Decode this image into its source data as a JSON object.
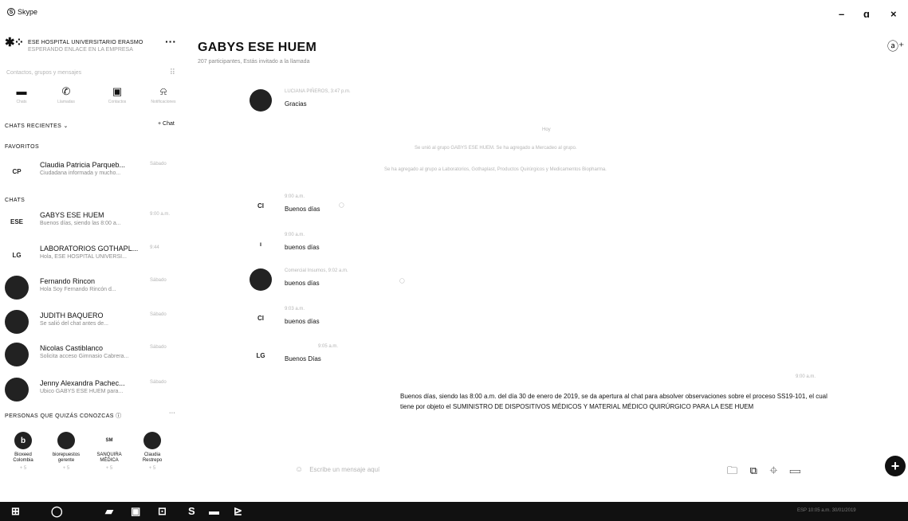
{
  "app": {
    "title": "Skype",
    "minimize": "–",
    "maximize": "ɑ",
    "close": "×"
  },
  "profile": {
    "name": "ESE HOSPITAL UNIVERSITARIO ERASMO",
    "status": "ESPERANDO ENLACE EN LA EMPRESA",
    "more": "···"
  },
  "search": {
    "placeholder": "Contactos, grupos y mensajes",
    "dialpad": "⠿"
  },
  "nav": [
    {
      "icon": "chat-icon",
      "glyph": "▬",
      "label": "Chats"
    },
    {
      "icon": "phone-icon",
      "glyph": "✆",
      "label": "Llamadas"
    },
    {
      "icon": "contacts-icon",
      "glyph": "▣",
      "label": "Contactos"
    },
    {
      "icon": "bell-icon",
      "glyph": "⍾",
      "label": "Notificaciones"
    }
  ],
  "sections": {
    "recent": "CHATS RECIENTES ⌄",
    "new_chat": "+ Chat",
    "favorites": "FAVORITOS",
    "chats": "CHATS",
    "people": "PERSONAS QUE QUIZÁS CONOZCAS  ⓘ",
    "people_more": "···"
  },
  "favorites": [
    {
      "initials": "CP",
      "name": "Claudia Patricia Parqueb...",
      "preview": "Ciudadana informada y mucho...",
      "time": "Sábado"
    }
  ],
  "chats": [
    {
      "initials": "ESE",
      "name": "GABYS ESE HUEM",
      "preview": "Buenos días, siendo las 8:00 a...",
      "time": "9:00 a.m."
    },
    {
      "initials": "LG",
      "name": "LABORATORIOS GOTHAPL...",
      "preview": "Hola, ESE HOSPITAL UNIVERSI...",
      "time": "9:44"
    },
    {
      "initials": "",
      "name": "Fernando Rincon",
      "preview": "Hola Soy Fernando Rincón d...",
      "time": "Sábado"
    },
    {
      "initials": "",
      "name": "JUDITH BAQUERO",
      "preview": "Se salió del chat antes de...",
      "time": "Sábado"
    },
    {
      "initials": "",
      "name": "Nicolas Castiblanco",
      "preview": "Solicita acceso Gimnasio Cabrera...",
      "time": "Sábado"
    },
    {
      "initials": "",
      "name": "Jenny Alexandra Pachec...",
      "preview": "Ubico GABYS ESE HUEM para...",
      "time": "Sábado"
    }
  ],
  "people": [
    {
      "glyph": "b",
      "name": "Bioxeed Colombia",
      "sub": "+ 5"
    },
    {
      "glyph": "",
      "name": "biorepuestos gerente",
      "sub": "+ 5"
    },
    {
      "glyph": "SM",
      "name": "SANQUIRA MÉDICA",
      "sub": "+ 5"
    },
    {
      "glyph": "",
      "name": "Claudia Restrepo",
      "sub": "+ 5"
    }
  ],
  "conversation": {
    "title": "GABYS ESE HUEM",
    "subtitle": "207 participantes, Estás invitado a la llamada",
    "add_person": "ⓐ⁺",
    "top_msg": {
      "sender": "LUCIANA PIÑEROS, 3:47 p.m.",
      "body": "Gracias"
    },
    "day_label": "Hoy",
    "system_lines": [
      "Se unió al grupo GABYS ESE HUEM. Se ha agregado a Mercadeo al grupo.",
      "Se ha agregado al grupo a Laboratorios, Gothaplast, Productos Quirúrgicos y Medicamentos Biopharma."
    ],
    "messages": [
      {
        "initials": "CI",
        "sender": "9:00 a.m.",
        "body": "Buenos días",
        "extra": "◯"
      },
      {
        "initials": "",
        "sender": "9:00 a.m.",
        "body": "buenos días",
        "extra": ""
      },
      {
        "initials": "",
        "sender": "Comercial Insumos, 9:02 a.m.",
        "body": "buenos días",
        "extra": "◯"
      },
      {
        "initials": "CI",
        "sender": "9:03 a.m.",
        "body": "buenos días",
        "extra": ""
      },
      {
        "initials": "LG",
        "sender": "9:05 a.m.",
        "body": "Buenos Días",
        "extra": ""
      }
    ],
    "own_time": "9:00 a.m.",
    "own_message": "Buenos días, siendo las 8:00 a.m. del día 30 de enero de 2019, se da apertura al chat para absolver observaciones sobre el proceso SS19-101, el cual tiene por objeto el SUMINISTRO DE DISPOSITIVOS MÉDICOS Y MATERIAL MÉDICO QUIRÚRGICO PARA LA ESE HUEM"
  },
  "composer": {
    "placeholder": "Escribe un mensaje aquí",
    "emoji": "☺",
    "tools": "🗀 ⧉ ⌖ ▭",
    "fab": "+"
  },
  "taskbar": {
    "start": "⊞",
    "items": [
      "◯",
      "▰",
      "▣",
      "⊡",
      "S",
      "▬",
      "⊵"
    ],
    "tray": "ESP  10:05 a.m.  30/01/2019"
  }
}
